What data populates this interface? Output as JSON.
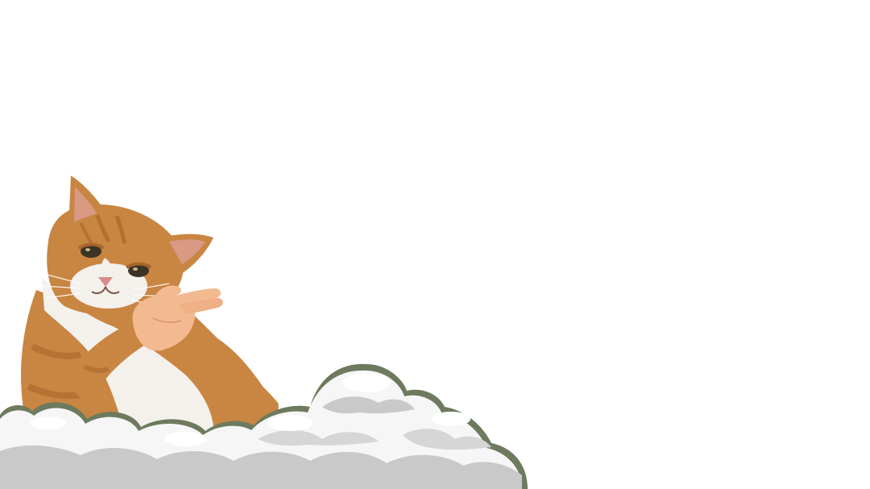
{
  "scene": {
    "background_color": "#ffffff",
    "subjects": [
      {
        "kind": "orange-tabby-cat",
        "gesture": "hand-pointing-right"
      },
      {
        "kind": "cloud-bank"
      }
    ]
  },
  "colors": {
    "fur_orange": "#c98542",
    "fur_dark": "#a8652c",
    "fur_light": "#e3a865",
    "fur_white": "#f4f1ec",
    "ear_inner": "#d99a84",
    "nose": "#d98a8a",
    "eye": "#3b3424",
    "hand": "#f3b990",
    "cloud_light": "#f6f6f6",
    "cloud_shadow": "#c9c9c9",
    "cloud_outline": "#6d7a5e"
  }
}
